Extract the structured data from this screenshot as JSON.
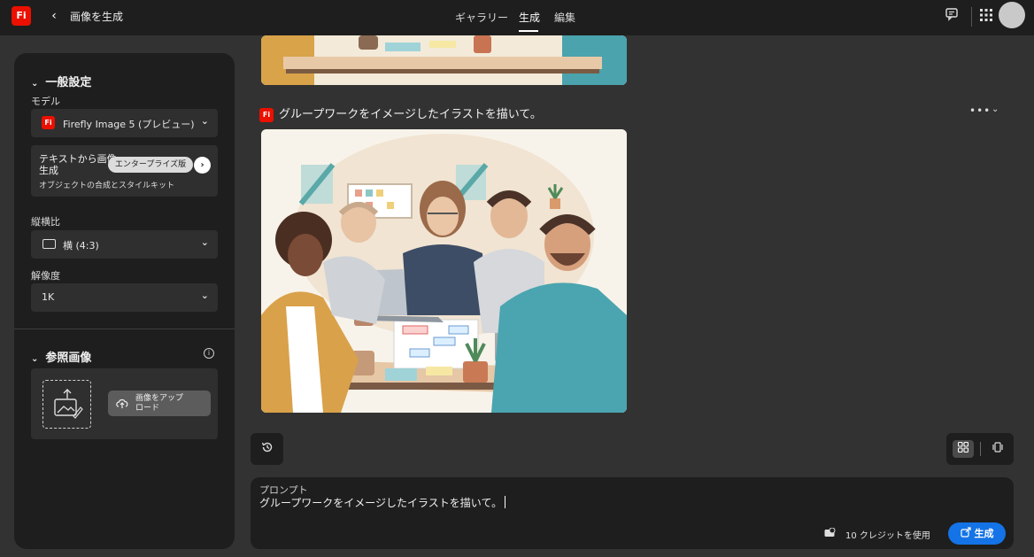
{
  "app": {
    "logo_text": "Fi",
    "title": "画像を生成",
    "nav": [
      {
        "label": "ギャラリー"
      },
      {
        "label": "生成"
      },
      {
        "label": "編集"
      }
    ],
    "active_nav": "生成"
  },
  "settings": {
    "general_title": "一般設定",
    "model_label": "モデル",
    "model_value": "Firefly Image 5 (プレビュー)",
    "promo_title": "テキストから画像生成",
    "promo_badge": "エンタープライズ版",
    "promo_sub": "オブジェクトの合成とスタイルキット",
    "aspect_label": "縦横比",
    "aspect_value": "横 (4:3)",
    "resolution_label": "解像度",
    "resolution_value": "1K",
    "reference_title": "参照画像",
    "upload_label": "画像をアップロード"
  },
  "generation": {
    "prompt_title": "グループワークをイメージしたイラストを描いて。",
    "more_icon": "more-icon",
    "collapse_icon": "chevron-down-icon"
  },
  "prompt": {
    "label": "プロンプト",
    "value": "グループワークをイメージしたイラストを描いて。",
    "credits": "10 クレジットを使用",
    "generate_label": "生成"
  },
  "colors": {
    "brand": "#eb1000",
    "accent": "#1473e6"
  }
}
